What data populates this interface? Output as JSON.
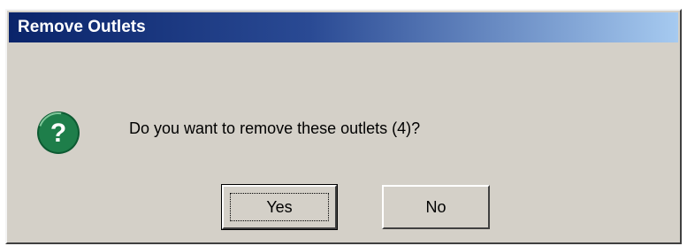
{
  "window": {
    "title": "Remove Outlets"
  },
  "dialog": {
    "icon": "question-icon",
    "message": "Do you want to remove these outlets (4)?",
    "buttons": {
      "yes_label": "Yes",
      "no_label": "No"
    },
    "default_button": "Yes"
  },
  "colors": {
    "title_bar_start": "#0a246a",
    "title_bar_end": "#a6caf0",
    "dialog_face": "#d4d0c8",
    "icon_green": "#1e7e4a"
  }
}
